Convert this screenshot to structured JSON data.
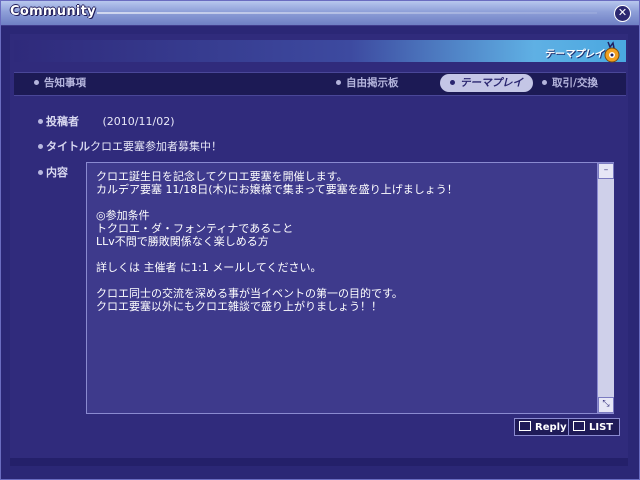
{
  "window": {
    "title": "Community"
  },
  "banner": {
    "label": "テーマプレイ",
    "icon": "theme-play-icon"
  },
  "tabs": [
    {
      "label": "告知事項",
      "active": false
    },
    {
      "label": "自由掲示板",
      "active": false
    },
    {
      "label": "テーマプレイ",
      "active": true
    },
    {
      "label": "取引/交換",
      "active": false
    }
  ],
  "post": {
    "poster_label": "投稿者",
    "poster_value": "(2010/11/02)",
    "title_label": "タイトル",
    "title_value": "クロエ要塞参加者募集中！",
    "content_label": "内容",
    "content_lines": [
      "クロエ誕生日を記念してクロエ要塞を開催します。",
      "カルデア要塞 11/18日(木)にお嬢様で集まって要塞を盛り上げましょう！",
      "",
      "◎参加条件",
      "トクロエ・ダ・フォンティナであること",
      "LLv不問で勝敗関係なく楽しめる方",
      "",
      "詳しくは 主催者 に1:1 メールしてください。",
      "",
      "クロエ同士の交流を深める事が当イベントの第一の目的です。",
      "クロエ要塞以外にもクロエ雑談で盛り上がりましょう！！"
    ]
  },
  "buttons": {
    "reply": "Reply",
    "list": "LIST"
  },
  "colors": {
    "background": "#2b2776",
    "active_tab": "#c4c6e6",
    "banner_accent": "#5fb0e4"
  }
}
